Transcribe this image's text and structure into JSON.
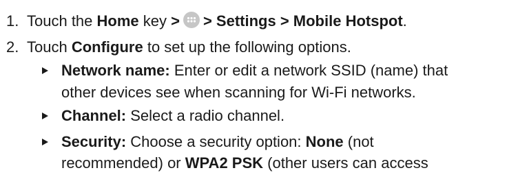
{
  "steps": [
    {
      "number": "1.",
      "pre": "Touch the ",
      "bold1": "Home",
      "mid": " key ",
      "sep1": ">",
      "sep2": "> Settings > Mobile Hotspot",
      "end": "."
    },
    {
      "number": "2.",
      "pre": "Touch ",
      "bold1": "Configure",
      "post": " to set up the following options."
    }
  ],
  "options": [
    {
      "label": "Network name:",
      "line1": " Enter or edit a network SSID (name) that",
      "line2": "other devices see when scanning for Wi-Fi networks."
    },
    {
      "label": "Channel:",
      "line1": " Select a radio channel."
    },
    {
      "label": "Security:",
      "line1a": " Choose a security option: ",
      "bold_a": "None",
      "line1b": " (not",
      "line2a": "recommended) or ",
      "bold_b": "WPA2 PSK",
      "line2b": " (other users can access"
    }
  ],
  "icons": {
    "apps": "apps-grid-icon",
    "bullet": "triangle-bullet-icon"
  },
  "colors": {
    "text": "#1a1a1a",
    "icon_circle": "#c6c6c6",
    "icon_dots": "#ffffff"
  }
}
